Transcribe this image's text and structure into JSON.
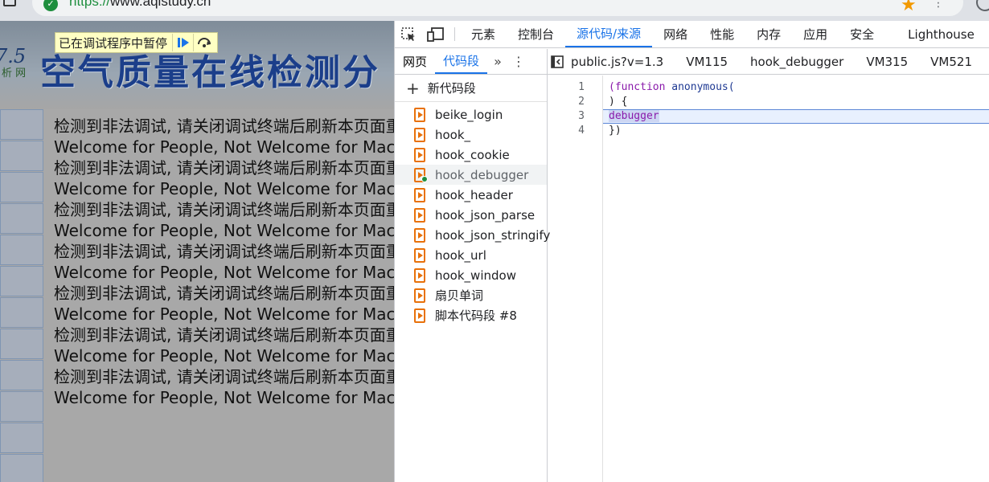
{
  "browser": {
    "url_scheme": "https://",
    "url_host": "www.aqistudy.cn"
  },
  "page": {
    "banner_num": "7.5",
    "banner_sub": "析 网",
    "banner_title": "空气质量在线检测分",
    "paused_text": "已在调试程序中暂停",
    "messages": [
      "检测到非法调试, 请关闭调试终端后刷新本页面重",
      "Welcome for People, Not Welcome for Mach",
      "检测到非法调试, 请关闭调试终端后刷新本页面重",
      "Welcome for People, Not Welcome for Mach",
      "检测到非法调试, 请关闭调试终端后刷新本页面重",
      "Welcome for People, Not Welcome for Mach",
      "检测到非法调试, 请关闭调试终端后刷新本页面重",
      "Welcome for People, Not Welcome for Mach",
      "检测到非法调试, 请关闭调试终端后刷新本页面重",
      "Welcome for People, Not Welcome for Mach",
      "检测到非法调试, 请关闭调试终端后刷新本页面重",
      "Welcome for People, Not Welcome for Mach",
      "检测到非法调试, 请关闭调试终端后刷新本页面重",
      "Welcome for People, Not Welcome for Mach"
    ]
  },
  "devtools": {
    "tabs": [
      "元素",
      "控制台",
      "源代码/来源",
      "网络",
      "性能",
      "内存",
      "应用",
      "安全",
      "Lighthouse"
    ],
    "active_tab": "源代码/来源",
    "sub_tabs": [
      "网页",
      "代码段"
    ],
    "active_sub_tab": "代码段",
    "new_snippet": "新代码段",
    "snippets": [
      "beike_login",
      "hook_",
      "hook_cookie",
      "hook_debugger",
      "hook_header",
      "hook_json_parse",
      "hook_json_stringify",
      "hook_url",
      "hook_window",
      "扇贝单词",
      "脚本代码段 #8"
    ],
    "selected_snippet": "hook_debugger",
    "editor_tabs": [
      "public.js?v=1.3",
      "VM115",
      "hook_debugger",
      "VM315",
      "VM521"
    ],
    "line_numbers": [
      "1",
      "2",
      "3",
      "4"
    ],
    "code": {
      "line1_kw": "(function",
      "line1_fn": " anonymous(",
      "line2": ") {",
      "line3": "debugger",
      "line4": "})"
    }
  }
}
